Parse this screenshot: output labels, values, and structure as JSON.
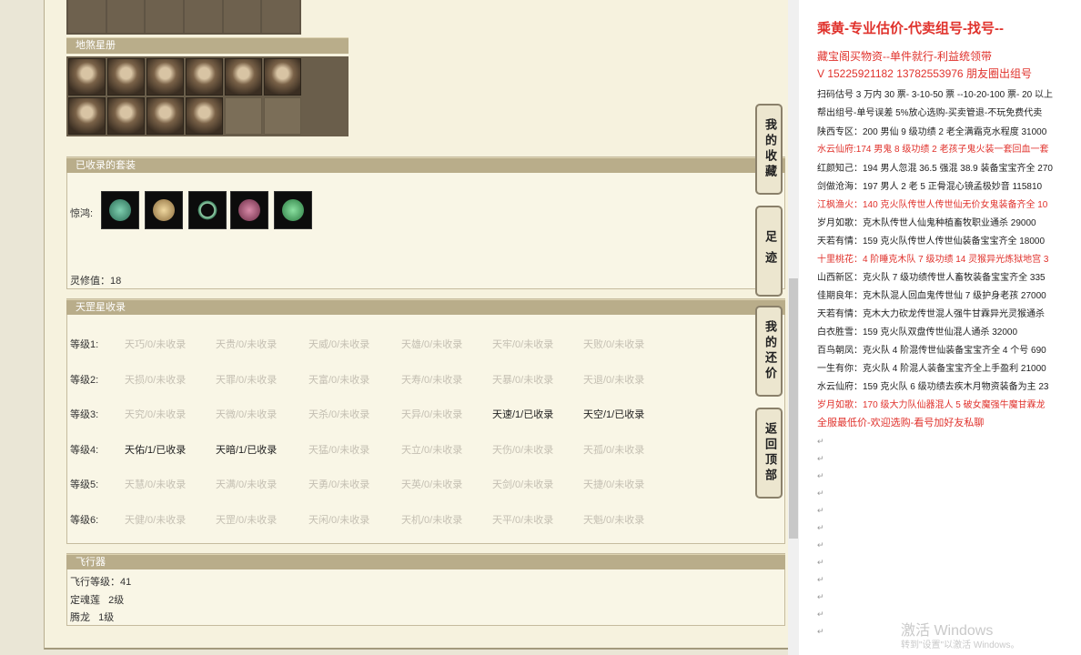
{
  "sections": {
    "heading1": "地煞星册",
    "heading2": "已收录的套装",
    "heading3": "天罡星收录",
    "heading4": "飞行器"
  },
  "suits": {
    "label": "惊鸿:",
    "lingxiu": "灵修值：18"
  },
  "tiangang": {
    "rows": [
      {
        "level": "等级1:",
        "cells": [
          "天巧/0/未收录",
          "天贵/0/未收录",
          "天威/0/未收录",
          "天雄/0/未收录",
          "天牢/0/未收录",
          "天败/0/未收录"
        ]
      },
      {
        "level": "等级2:",
        "cells": [
          "天损/0/未收录",
          "天罪/0/未收录",
          "天富/0/未收录",
          "天寿/0/未收录",
          "天暴/0/未收录",
          "天退/0/未收录"
        ]
      },
      {
        "level": "等级3:",
        "cells": [
          "天究/0/未收录",
          "天微/0/未收录",
          "天杀/0/未收录",
          "天异/0/未收录",
          "天速/1/已收录",
          "天空/1/已收录"
        ]
      },
      {
        "level": "等级4:",
        "cells": [
          "天佑/1/已收录",
          "天暗/1/已收录",
          "天猛/0/未收录",
          "天立/0/未收录",
          "天伤/0/未收录",
          "天孤/0/未收录"
        ]
      },
      {
        "level": "等级5:",
        "cells": [
          "天慧/0/未收录",
          "天满/0/未收录",
          "天勇/0/未收录",
          "天英/0/未收录",
          "天剑/0/未收录",
          "天捷/0/未收录"
        ]
      },
      {
        "level": "等级6:",
        "cells": [
          "天健/0/未收录",
          "天罡/0/未收录",
          "天闲/0/未收录",
          "天机/0/未收录",
          "天平/0/未收录",
          "天魁/0/未收录"
        ]
      }
    ],
    "collected": [
      [
        false,
        false,
        false,
        false,
        false,
        false
      ],
      [
        false,
        false,
        false,
        false,
        false,
        false
      ],
      [
        false,
        false,
        false,
        false,
        true,
        true
      ],
      [
        true,
        true,
        false,
        false,
        false,
        false
      ],
      [
        false,
        false,
        false,
        false,
        false,
        false
      ],
      [
        false,
        false,
        false,
        false,
        false,
        false
      ]
    ]
  },
  "aircraft": {
    "level": "飞行等级：41",
    "item1": "定魂莲   2级",
    "item2": "腾龙   1级"
  },
  "side_buttons": {
    "favorites": "我的收藏",
    "footprint": "足迹",
    "bargain": "我的还价",
    "back_top": "返回顶部"
  },
  "document": {
    "lines": [
      {
        "text": "乘黄-专业估价-代卖组号-找号--",
        "style": "title"
      },
      {
        "text": "藏宝阁买物资--单件就行-利益统领带",
        "style": "red"
      },
      {
        "text": "V 15225921182    13782553976 朋友圈出组号",
        "style": "red"
      },
      {
        "text": "扫码估号 3 万内 30 票- 3-10-50 票  --10-20-100 票- 20 以上",
        "style": ""
      },
      {
        "text": "帮出组号-单号误差 5%放心选购-买卖管退-不玩免费代卖",
        "style": ""
      },
      {
        "text": "陕西专区：200 男仙 9 级功绩 2 老全满霜克水程度 31000",
        "style": ""
      },
      {
        "text": "水云仙府:174 男鬼 8 级功绩 2 老孩子鬼火装一套回血一套",
        "style": "red"
      },
      {
        "text": "红颜知己：194 男人忽混 36.5 强混 38.9 装备宝宝齐全 270",
        "style": ""
      },
      {
        "text": "剑做沧海：197 男人 2 老 5 正骨混心镜孟极妙音 115810",
        "style": ""
      },
      {
        "text": "江枫渔火：140 克火队传世人传世仙无价女鬼装备齐全 10",
        "style": "red"
      },
      {
        "text": "岁月如歌：克木队传世人仙鬼种植畜牧职业通杀 29000",
        "style": ""
      },
      {
        "text": "天若有情：159 克火队传世人传世仙装备宝宝齐全 18000",
        "style": ""
      },
      {
        "text": "十里桃花：4 阶睡克木队 7 级功绩 14 灵猴异光炼狱地宫 3",
        "style": "red"
      },
      {
        "text": "山西新区：克火队 7 级功绩传世人畜牧装备宝宝齐全 335",
        "style": ""
      },
      {
        "text": "佳期良年：克木队混人回血鬼传世仙 7 级护身老孩 27000",
        "style": ""
      },
      {
        "text": "天若有情：克木大力砍龙传世混人强牛甘霖异光灵猴通杀",
        "style": ""
      },
      {
        "text": "白衣胜雪：159 克火队双盘传世仙混人通杀 32000",
        "style": ""
      },
      {
        "text": "百鸟朝凤：克火队 4 阶混传世仙装备宝宝齐全 4 个号 690",
        "style": ""
      },
      {
        "text": "一生有你：克火队 4 阶混人装备宝宝齐全上手盈利 21000",
        "style": ""
      },
      {
        "text": "水云仙府：159 克火队 6 级功绩去疾木月物资装备为主 23",
        "style": ""
      },
      {
        "text": "岁月如歌：170 级大力队仙器混人 5 破女魔强牛魔甘霖龙",
        "style": "red"
      },
      {
        "text": "全服最低价-欢迎选购-看号加好友私聊",
        "style": "red"
      }
    ],
    "watermark_main": "激活 Windows",
    "watermark_sub": "转到\"设置\"以激活 Windows。"
  },
  "colors": {
    "accent_red": "#e0322c",
    "section_bar": "#b9ad8a",
    "panel_bg": "#f9f6e6"
  }
}
